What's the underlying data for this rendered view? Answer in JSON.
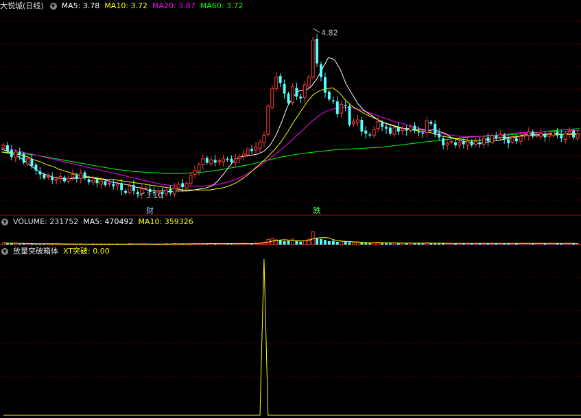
{
  "main_header": {
    "title": "大悦城(日线)",
    "ma5": "MA5: 3.78",
    "ma10": "MA10: 3.72",
    "ma20": "MA20: 3.87",
    "ma60": "MA60: 3.72"
  },
  "volume_header": {
    "volume": "VOLUME: 231752",
    "ma5": "MA5: 470492",
    "ma10": "MA10: 359326"
  },
  "indicator_header": {
    "name": "放量突破箱体",
    "xt": "XT突破: 0.00"
  },
  "colors": {
    "up": "#ff3c3c",
    "down": "#54ffff",
    "ma5": "#ffffff",
    "ma10": "#ffff00",
    "ma20": "#ff00ff",
    "ma60": "#00ff00",
    "axis": "#a01010"
  },
  "chart_data": [
    {
      "type": "candlestick",
      "high_label": "4.82",
      "low_label": "3.10",
      "high_value": 4.82,
      "low_value": 3.1,
      "events": [
        {
          "label": "财",
          "at_bar": 36
        },
        {
          "label": "跌",
          "at_bar": 77
        }
      ],
      "ohlc_close_sequence": [
        3.62,
        3.56,
        3.5,
        3.55,
        3.52,
        3.44,
        3.48,
        3.41,
        3.36,
        3.32,
        3.28,
        3.3,
        3.26,
        3.27,
        3.3,
        3.25,
        3.28,
        3.32,
        3.28,
        3.33,
        3.28,
        3.24,
        3.26,
        3.23,
        3.25,
        3.21,
        3.23,
        3.2,
        3.22,
        3.16,
        3.13,
        3.2,
        3.15,
        3.12,
        3.17,
        3.18,
        3.14,
        3.13,
        3.15,
        3.12,
        3.16,
        3.13,
        3.18,
        3.22,
        3.19,
        3.23,
        3.31,
        3.36,
        3.42,
        3.48,
        3.44,
        3.47,
        3.44,
        3.46,
        3.48,
        3.47,
        3.45,
        3.48,
        3.5,
        3.53,
        3.58,
        3.56,
        3.6,
        3.65,
        3.72,
        4.02,
        4.2,
        4.32,
        4.26,
        4.15,
        4.05,
        4.22,
        4.12,
        4.1,
        4.24,
        4.32,
        4.7,
        4.46,
        4.32,
        4.16,
        4.09,
        4.07,
        3.94,
        4.04,
        4.02,
        3.83,
        3.86,
        3.88,
        3.76,
        3.74,
        3.72,
        3.78,
        3.86,
        3.81,
        3.79,
        3.74,
        3.8,
        3.76,
        3.79,
        3.77,
        3.81,
        3.77,
        3.75,
        3.74,
        3.87,
        3.84,
        3.73,
        3.7,
        3.62,
        3.64,
        3.66,
        3.62,
        3.65,
        3.63,
        3.66,
        3.62,
        3.66,
        3.63,
        3.69,
        3.66,
        3.72,
        3.69,
        3.73,
        3.68,
        3.64,
        3.7,
        3.66,
        3.71,
        3.73,
        3.76,
        3.71,
        3.72,
        3.74,
        3.7,
        3.73,
        3.76,
        3.72,
        3.69,
        3.74,
        3.76,
        3.7,
        3.74
      ],
      "ma5_line": [
        3.58,
        3.56,
        3.53,
        3.5,
        3.46,
        3.41,
        3.37,
        3.33,
        3.31,
        3.29,
        3.28,
        3.27,
        3.28,
        3.28,
        3.29,
        3.29,
        3.28,
        3.27,
        3.26,
        3.24,
        3.23,
        3.22,
        3.21,
        3.19,
        3.18,
        3.16,
        3.15,
        3.15,
        3.15,
        3.14,
        3.15,
        3.15,
        3.15,
        3.16,
        3.17,
        3.18,
        3.2,
        3.25,
        3.32,
        3.4,
        3.47,
        3.5,
        3.51,
        3.52,
        3.53,
        3.56,
        3.62,
        3.72,
        3.86,
        4.02,
        4.12,
        4.18,
        4.18,
        4.22,
        4.3,
        4.41,
        4.52,
        4.5,
        4.4,
        4.25,
        4.15,
        4.05,
        3.98,
        3.94,
        3.9,
        3.86,
        3.84,
        3.82,
        3.8,
        3.79,
        3.79,
        3.78,
        3.78,
        3.77,
        3.78,
        3.76,
        3.74,
        3.7,
        3.68,
        3.66,
        3.65,
        3.64,
        3.64,
        3.65,
        3.66,
        3.67,
        3.68,
        3.69,
        3.7,
        3.72,
        3.73,
        3.73,
        3.73,
        3.73,
        3.74,
        3.74,
        3.73,
        3.74,
        3.74,
        3.73
      ],
      "ma10_line": [
        3.55,
        3.54,
        3.53,
        3.52,
        3.5,
        3.47,
        3.45,
        3.42,
        3.4,
        3.37,
        3.35,
        3.33,
        3.31,
        3.3,
        3.29,
        3.28,
        3.27,
        3.27,
        3.26,
        3.25,
        3.24,
        3.23,
        3.22,
        3.21,
        3.2,
        3.19,
        3.18,
        3.17,
        3.16,
        3.16,
        3.16,
        3.16,
        3.16,
        3.17,
        3.18,
        3.2,
        3.23,
        3.27,
        3.32,
        3.38,
        3.44,
        3.5,
        3.57,
        3.65,
        3.75,
        3.86,
        3.96,
        4.06,
        4.14,
        4.18,
        4.2,
        4.21,
        4.16,
        4.08,
        4.02,
        3.98,
        3.94,
        3.91,
        3.88,
        3.85,
        3.83,
        3.81,
        3.79,
        3.78,
        3.77,
        3.76,
        3.75,
        3.73,
        3.71,
        3.7,
        3.69,
        3.68,
        3.67,
        3.67,
        3.67,
        3.68,
        3.69,
        3.7,
        3.7,
        3.71,
        3.71,
        3.72,
        3.72,
        3.72,
        3.73,
        3.73,
        3.73,
        3.73,
        3.73,
        3.73
      ],
      "ma20_line": [
        3.6,
        3.58,
        3.56,
        3.54,
        3.52,
        3.5,
        3.48,
        3.46,
        3.44,
        3.42,
        3.4,
        3.38,
        3.36,
        3.34,
        3.32,
        3.3,
        3.28,
        3.26,
        3.24,
        3.22,
        3.21,
        3.2,
        3.2,
        3.2,
        3.2,
        3.21,
        3.22,
        3.24,
        3.27,
        3.31,
        3.36,
        3.42,
        3.48,
        3.55,
        3.62,
        3.7,
        3.78,
        3.86,
        3.93,
        3.98,
        4.0,
        4.01,
        4.0,
        3.98,
        3.95,
        3.92,
        3.89,
        3.86,
        3.84,
        3.81,
        3.79,
        3.77,
        3.75,
        3.73,
        3.72,
        3.71,
        3.71,
        3.71,
        3.72,
        3.72,
        3.73,
        3.74,
        3.75,
        3.75,
        3.75,
        3.76,
        3.76,
        3.76,
        3.77,
        3.77
      ],
      "ma60_line": [
        3.55,
        3.54,
        3.52,
        3.49,
        3.46,
        3.43,
        3.4,
        3.37,
        3.35,
        3.34,
        3.33,
        3.33,
        3.34,
        3.36,
        3.39,
        3.42,
        3.46,
        3.5,
        3.53,
        3.55,
        3.57,
        3.58,
        3.59,
        3.6,
        3.62,
        3.64,
        3.66,
        3.68,
        3.7,
        3.71,
        3.72,
        3.73,
        3.74,
        3.76,
        3.78,
        3.79
      ],
      "volume_values": [
        0.8,
        0.6,
        0.5,
        0.7,
        0.4,
        0.5,
        0.4,
        0.3,
        0.5,
        0.4,
        0.3,
        0.4,
        0.3,
        0.4,
        0.3,
        0.2,
        0.3,
        0.3,
        0.2,
        0.3,
        0.2,
        0.3,
        0.2,
        0.3,
        0.2,
        0.3,
        0.3,
        0.2,
        0.3,
        0.2,
        0.3,
        0.4,
        0.3,
        0.2,
        0.3,
        0.2,
        0.3,
        0.2,
        0.3,
        0.3,
        0.4,
        0.3,
        0.4,
        0.3,
        0.4,
        0.3,
        0.4,
        0.5,
        0.4,
        0.5,
        0.4,
        0.6,
        0.5,
        0.4,
        0.5,
        0.4,
        0.5,
        0.4,
        0.5,
        0.6,
        0.5,
        0.6,
        0.7,
        0.8,
        1.2,
        2.4,
        3.0,
        2.2,
        2.0,
        1.6,
        1.8,
        2.6,
        1.6,
        1.4,
        1.9,
        2.5,
        6.0,
        3.2,
        2.6,
        2.1,
        1.6,
        1.8,
        1.3,
        1.5,
        1.4,
        1.1,
        1.0,
        1.1,
        0.9,
        0.8,
        0.7,
        0.9,
        1.1,
        0.8,
        0.7,
        0.6,
        0.8,
        0.7,
        0.6,
        0.7,
        0.8,
        0.6,
        0.7,
        0.5,
        0.9,
        0.7,
        0.6,
        0.5,
        0.6,
        0.5,
        0.6,
        0.5,
        0.6,
        0.5,
        0.6,
        0.5,
        0.6,
        0.5,
        0.6,
        0.5,
        0.7,
        0.6,
        0.5,
        0.6,
        0.5,
        0.6,
        0.5,
        0.6,
        0.7,
        0.6,
        0.5,
        0.6,
        0.5,
        0.6,
        0.5,
        0.6,
        0.5,
        0.6,
        0.5,
        0.6,
        0.5,
        0.4
      ],
      "indicator_values": [
        0,
        0,
        0,
        0,
        0,
        0,
        0,
        0,
        0,
        0,
        0,
        0,
        0,
        0,
        0,
        0,
        0,
        0,
        0,
        0,
        0,
        0,
        0,
        0,
        0,
        0,
        0,
        0,
        0,
        0,
        0,
        0,
        0,
        0,
        0,
        0,
        0,
        0,
        0,
        0,
        0,
        0,
        0,
        0,
        0,
        0,
        0,
        0,
        0,
        0,
        0,
        0,
        0,
        0,
        0,
        0,
        0,
        0,
        0,
        0,
        0,
        0,
        0,
        0,
        1,
        0,
        0,
        0,
        0,
        0,
        0,
        0,
        0,
        0,
        0,
        0,
        0,
        0,
        0,
        0,
        0,
        0,
        0,
        0,
        0,
        0,
        0,
        0,
        0,
        0,
        0,
        0,
        0,
        0,
        0,
        0,
        0,
        0,
        0,
        0,
        0,
        0,
        0,
        0,
        0,
        0,
        0,
        0,
        0,
        0,
        0,
        0,
        0,
        0,
        0,
        0,
        0,
        0,
        0,
        0,
        0,
        0,
        0,
        0,
        0,
        0,
        0,
        0,
        0,
        0,
        0,
        0,
        0,
        0,
        0,
        0,
        0,
        0,
        0,
        0,
        0,
        0,
        0,
        0
      ]
    }
  ]
}
